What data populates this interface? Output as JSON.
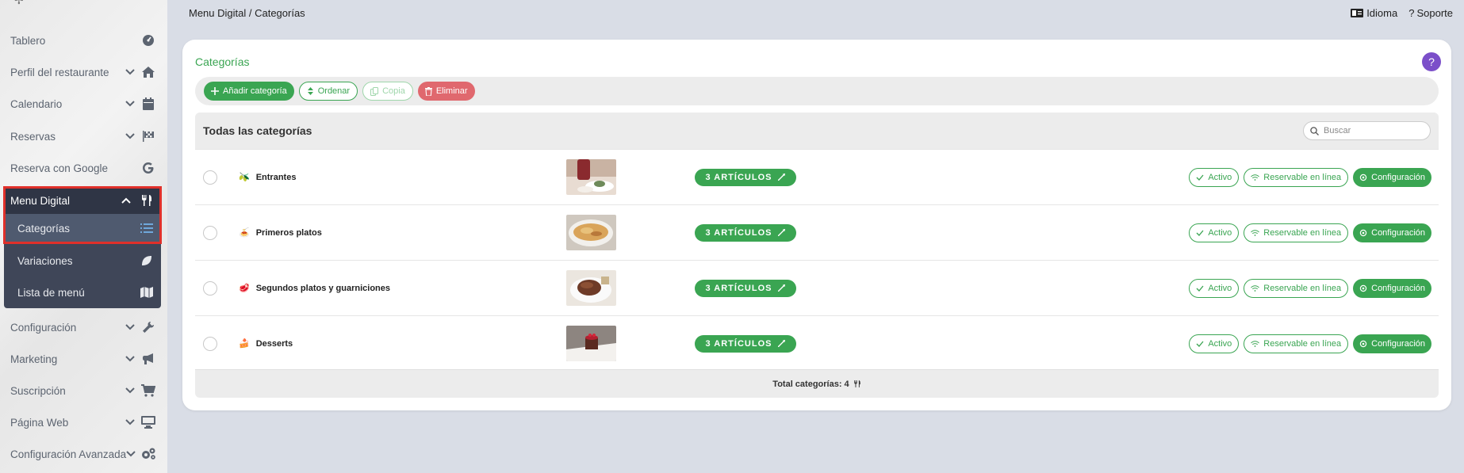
{
  "topbar": {
    "breadcrumb": "Menu Digital / Categorías",
    "language_label": "Idioma",
    "support_label": "Soporte"
  },
  "sidebar": {
    "items": [
      {
        "label": "Tablero",
        "icon": "dashboard-icon"
      },
      {
        "label": "Perfil del restaurante",
        "icon": "home-icon"
      },
      {
        "label": "Calendario",
        "icon": "calendar-icon"
      },
      {
        "label": "Reservas",
        "icon": "flag-checkered-icon"
      },
      {
        "label": "Reserva con Google",
        "icon": "google-icon"
      },
      {
        "label": "Menu Digital",
        "icon": "utensils-icon"
      },
      {
        "label": "Configuración",
        "icon": "wrench-icon"
      },
      {
        "label": "Marketing",
        "icon": "megaphone-icon"
      },
      {
        "label": "Suscripción",
        "icon": "cart-icon"
      },
      {
        "label": "Página Web",
        "icon": "monitor-icon"
      },
      {
        "label": "Configuración Avanzada",
        "icon": "cogs-icon"
      }
    ],
    "submenu": [
      {
        "label": "Categorías",
        "icon": "list-icon"
      },
      {
        "label": "Variaciones",
        "icon": "leaf-icon"
      },
      {
        "label": "Lista de menú",
        "icon": "map-icon"
      }
    ]
  },
  "card": {
    "title": "Categorías",
    "help": "?",
    "toolbar": {
      "add": "Añadir categoría",
      "order": "Ordenar",
      "copy": "Copia",
      "delete": "Eliminar"
    },
    "table_title": "Todas las categorías",
    "search_placeholder": "Buscar",
    "rows": [
      {
        "name": "Entrantes",
        "emoji": "🫒",
        "articles": "3 ARTÍCULOS"
      },
      {
        "name": "Primeros platos",
        "emoji": "🍝",
        "articles": "3 ARTÍCULOS"
      },
      {
        "name": "Segundos platos y guarniciones",
        "emoji": "🥩",
        "articles": "3 ARTÍCULOS"
      },
      {
        "name": "Desserts",
        "emoji": "🍰",
        "articles": "3 ARTÍCULOS"
      }
    ],
    "row_actions": {
      "active": "Activo",
      "bookable": "Reservable en línea",
      "config": "Configuración"
    },
    "footer": "Total categorías: 4"
  },
  "colors": {
    "accent_green": "#3aa552",
    "danger_red": "#e0686e",
    "help_purple": "#7b4fc9",
    "sidebar_dark": "#3f4658",
    "highlight_red": "#e0302a"
  }
}
